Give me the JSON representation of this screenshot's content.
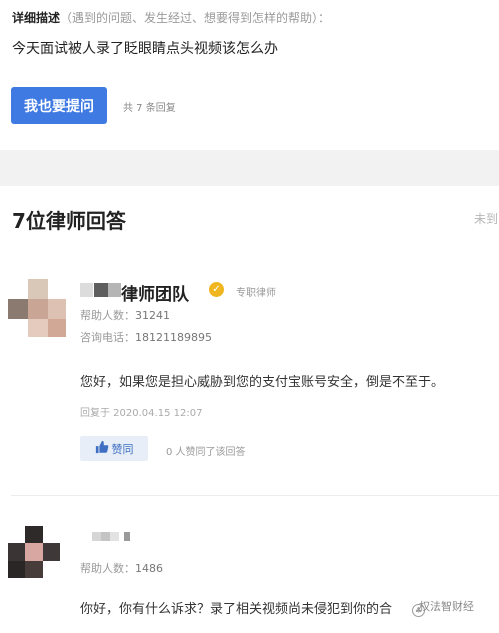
{
  "question": {
    "desc_label": "详细描述",
    "desc_hint": "（遇到的问题、发生经过、想要得到怎样的帮助）：",
    "text": "今天面试被人录了眨眼睛点头视频该怎么办",
    "ask_button_label": "我也要提问",
    "reply_count_text": "共 7 条回复"
  },
  "answers_section": {
    "title": "7位律师回答",
    "unresolved_text": "未到"
  },
  "lawyers": [
    {
      "name": "律师团队",
      "verified_icon": "check-badge-icon",
      "role": "专职律师",
      "helped_label": "帮助人数：",
      "helped_value": "31241",
      "phone_label": "咨询电话：",
      "phone_value": "18121189895",
      "answer": "您好，如果您是担心威胁到您的支付宝账号安全，倒是不至于。",
      "reply_time": "回复于 2020.04.15 12:07",
      "like_label": "赞同",
      "like_icon": "thumbs-up-icon",
      "like_count_text": "0 人赞同了该回答"
    },
    {
      "helped_label": "帮助人数：",
      "helped_value": "1486",
      "answer": "你好，你有什么诉求？录了相关视频尚未侵犯到你的合"
    }
  ],
  "watermark": {
    "text": "权法智财经",
    "icon": "watermark-logo-icon"
  },
  "colors": {
    "primary_button": "#3e7ae2",
    "separator_band": "#f2f2f3",
    "verified_badge": "#f0b61f",
    "like_button_bg": "#e8eef8"
  }
}
